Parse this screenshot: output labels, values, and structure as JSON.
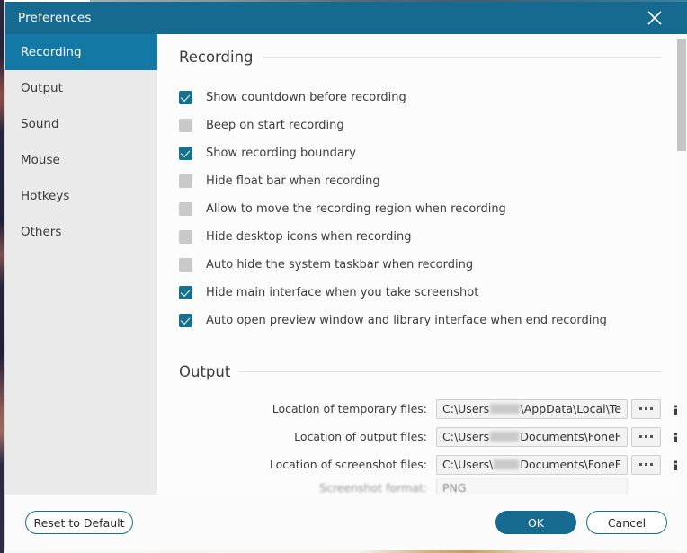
{
  "window": {
    "title": "Preferences",
    "close_icon": "close-icon",
    "accent_color": "#16698f",
    "sidebar_bg": "#eaeaea",
    "active_nav_color": "#1379a4"
  },
  "sidebar": {
    "items": [
      {
        "label": "Recording",
        "active": true
      },
      {
        "label": "Output",
        "active": false
      },
      {
        "label": "Sound",
        "active": false
      },
      {
        "label": "Mouse",
        "active": false
      },
      {
        "label": "Hotkeys",
        "active": false
      },
      {
        "label": "Others",
        "active": false
      }
    ]
  },
  "recording_section": {
    "heading": "Recording",
    "options": [
      {
        "label": "Show countdown before recording",
        "checked": true
      },
      {
        "label": "Beep on start recording",
        "checked": false
      },
      {
        "label": "Show recording boundary",
        "checked": true
      },
      {
        "label": "Hide float bar when recording",
        "checked": false
      },
      {
        "label": "Allow to move the recording region when recording",
        "checked": false
      },
      {
        "label": "Hide desktop icons when recording",
        "checked": false
      },
      {
        "label": "Auto hide the system taskbar when recording",
        "checked": false
      },
      {
        "label": "Hide main interface when you take screenshot",
        "checked": true
      },
      {
        "label": "Auto open preview window and library interface when end recording",
        "checked": true
      }
    ]
  },
  "output_section": {
    "heading": "Output",
    "rows": [
      {
        "label": "Location of temporary files:",
        "value_prefix": "C:\\Users",
        "value_suffix": "\\AppData\\Local\\Te",
        "redacted": true,
        "browse_label": "...",
        "folder_icon": "folder-icon"
      },
      {
        "label": "Location of output files:",
        "value_prefix": "C:\\Users",
        "value_suffix": "Documents\\FoneF",
        "redacted": true,
        "browse_label": "...",
        "folder_icon": "folder-icon"
      },
      {
        "label": "Location of screenshot files:",
        "value_prefix": "C:\\Users\\",
        "value_suffix": "Documents\\FoneF",
        "redacted": true,
        "browse_label": "...",
        "folder_icon": "folder-icon"
      }
    ],
    "clipped_row": {
      "label": "Screenshot format:",
      "value": "PNG"
    }
  },
  "scrollbar": {
    "orientation": "vertical",
    "thumb_color": "#c4c4c4"
  },
  "footer": {
    "reset_label": "Reset to Default",
    "ok_label": "OK",
    "cancel_label": "Cancel"
  }
}
